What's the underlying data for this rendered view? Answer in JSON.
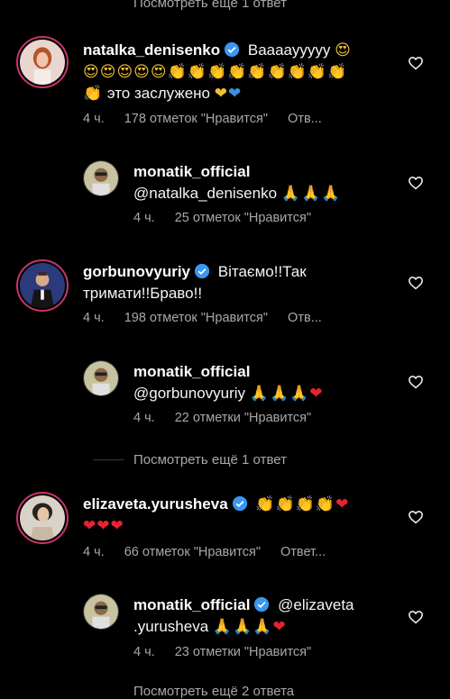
{
  "view_more_top": "Посмотреть ещё 1 ответ",
  "view_more_mid": "Посмотреть ещё 1 ответ",
  "view_more_bottom": "Посмотреть ещё 2 ответа",
  "comments": [
    {
      "username": "natalka_denisenko",
      "text_line1": "Вааааууууу",
      "text_line3": "это заслужено",
      "time": "4 ч.",
      "likes": "178 отметок \"Нравится\"",
      "reply": "Отв..."
    },
    {
      "username": "monatik_official",
      "mention": "@natalka_denisenko",
      "time": "4 ч.",
      "likes": "25 отметок \"Нравится\""
    },
    {
      "username": "gorbunovyuriy",
      "text_line1": "Вітаємо!!Так",
      "text_line2": "тримати!!Браво!!",
      "time": "4 ч.",
      "likes": "198 отметок \"Нравится\"",
      "reply": "Отв..."
    },
    {
      "username": "monatik_official",
      "mention": "@gorbunovyuriy",
      "time": "4 ч.",
      "likes": "22 отметки \"Нравится\""
    },
    {
      "username": "elizaveta.yurusheva",
      "time": "4 ч.",
      "likes": "66 отметок \"Нравится\"",
      "reply": "Ответ..."
    },
    {
      "username": "monatik_official",
      "mention": "@elizaveta",
      "mention_cont": ".yurusheva",
      "time": "4 ч.",
      "likes": "23 отметки \"Нравится\""
    }
  ],
  "icons": {
    "heart": "heart-outline-icon",
    "verified": "verified-badge-icon",
    "emoji": [
      "heart-eyes-emoji",
      "clapping-hands-emoji",
      "yellow-heart-emoji",
      "blue-heart-emoji",
      "praying-hands-emoji",
      "red-heart-emoji"
    ]
  },
  "colors": {
    "background": "#000000",
    "text": "#f5f5f5",
    "secondary": "#a8a8a8",
    "verified": "#3897f0",
    "story_ring": "#c9336b"
  }
}
